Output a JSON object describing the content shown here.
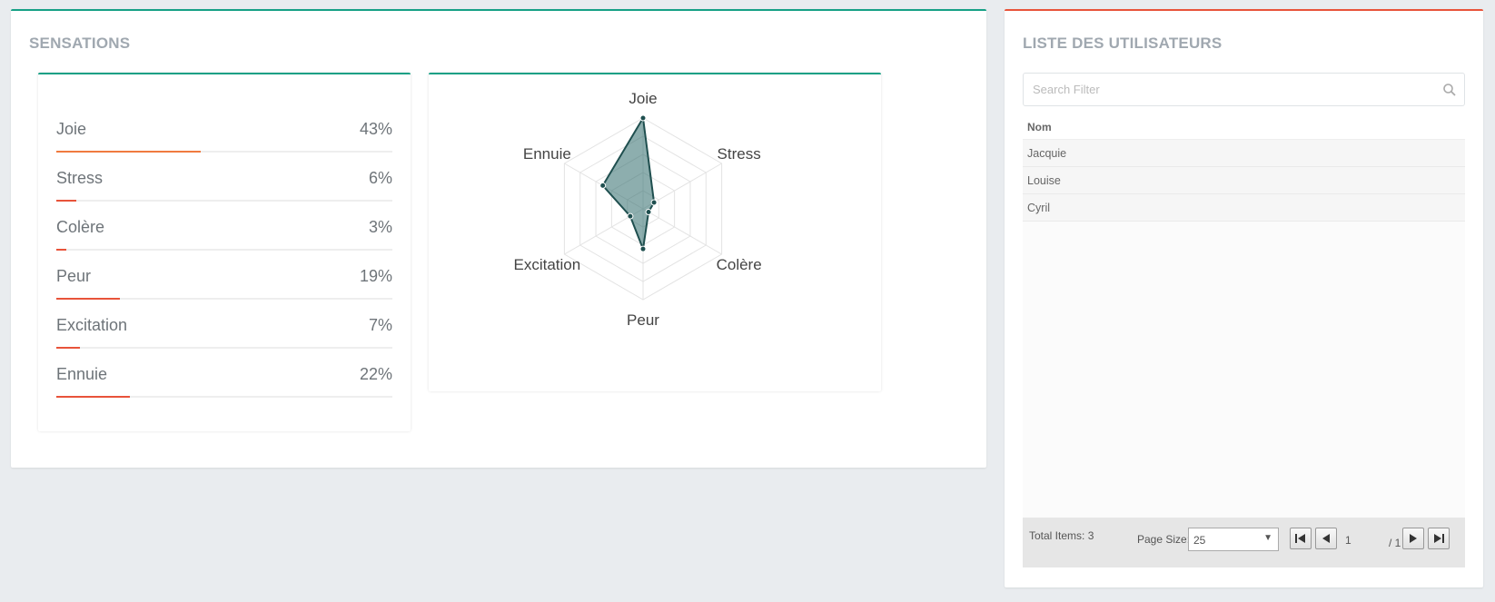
{
  "sensations": {
    "title": "SENSATIONS",
    "items": [
      {
        "label": "Joie",
        "value": "43%",
        "percent": 43
      },
      {
        "label": "Stress",
        "value": "6%",
        "percent": 6
      },
      {
        "label": "Colère",
        "value": "3%",
        "percent": 3
      },
      {
        "label": "Peur",
        "value": "19%",
        "percent": 19
      },
      {
        "label": "Excitation",
        "value": "7%",
        "percent": 7
      },
      {
        "label": "Ennuie",
        "value": "22%",
        "percent": 22
      }
    ],
    "bar_color_start": "#f07b3f",
    "bar_color_end": "#e8533a"
  },
  "chart_data": {
    "type": "radar",
    "axes": [
      "Joie",
      "Stress",
      "Colère",
      "Peur",
      "Excitation",
      "Ennuie"
    ],
    "values": [
      43,
      6,
      3,
      19,
      7,
      22
    ],
    "rmax": 43,
    "rings": 5,
    "fill_color": "#2f6b6b",
    "line_color": "#1f4f4f"
  },
  "users": {
    "title": "LISTE DES UTILISATEURS",
    "search_placeholder": "Search Filter",
    "column_header": "Nom",
    "rows": [
      "Jacquie",
      "Louise",
      "Cyril"
    ],
    "pager": {
      "total_items": "Total Items: 3",
      "page_size_label": "Page Size:",
      "page_size_value": "25",
      "current_page": "1",
      "total_pages": "/ 1"
    }
  }
}
